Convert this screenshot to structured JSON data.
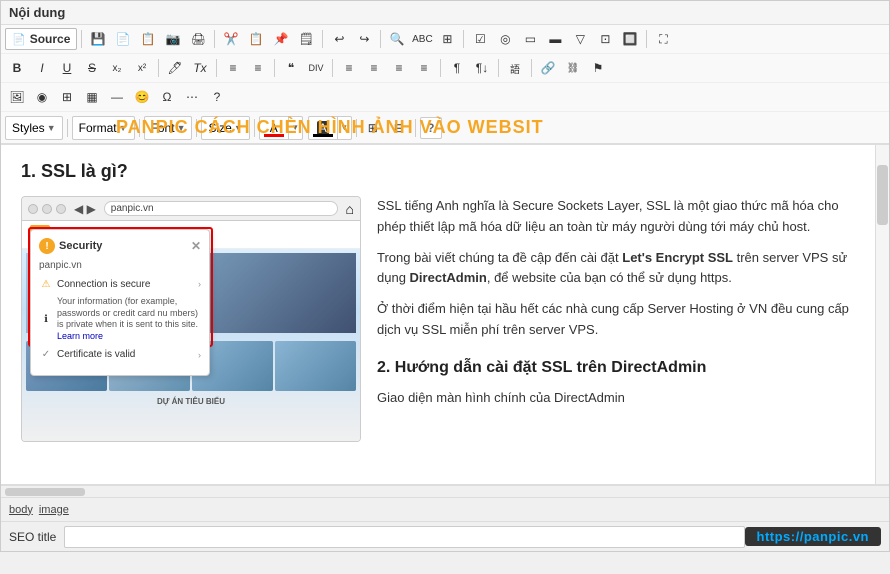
{
  "header": {
    "title": "Nội dung"
  },
  "toolbar": {
    "source_label": "Source",
    "row1_icons": [
      "💾",
      "📄",
      "📋",
      "📷",
      "✂️",
      "📋",
      "📌",
      "🔒",
      "↩️",
      "↪️",
      "🔍",
      "📊",
      "📋",
      "✔️",
      "⭕",
      "▭",
      "▭",
      "▬",
      "✏️"
    ],
    "row2_icons": [
      "B",
      "I",
      "U",
      "S",
      "x₂",
      "x²",
      "🖊",
      "Ix",
      "≡",
      "≡",
      "❝",
      "❝",
      "DIV",
      "≡",
      "≡",
      "≡",
      "≡",
      "¶",
      "¶",
      "語",
      "🔗",
      "⚑",
      "⚑"
    ],
    "row3_icons": [
      "🖼",
      "⊕",
      "▦",
      "▦",
      "🔧",
      "📸",
      "◎",
      "▲",
      "?"
    ]
  },
  "format_bar": {
    "styles_label": "Styles",
    "format_label": "Format",
    "font_label": "Font",
    "size_label": "Size",
    "text_color_label": "A",
    "bg_color_label": "A",
    "help_label": "?"
  },
  "banner": {
    "text": "PANPIC CÁCH CHÈN HÌNH ẢNH VÀO WEBSIT"
  },
  "content": {
    "heading1": "1. SSL là gì?",
    "paragraph1": "SSL tiếng Anh nghĩa là Secure Sockets Layer, SSL là một giao thức mã hóa cho phép thiết lập mã hóa dữ liệu an toàn từ máy người dùng  tới máy chủ host.",
    "paragraph2_prefix": "Trong bài viết chúng ta đề cập đến cài đặt ",
    "paragraph2_bold": "Let's Encrypt SSL",
    "paragraph2_suffix": " trên server VPS sử dụng ",
    "paragraph2_bold2": "DirectAdmin",
    "paragraph2_end": ", để website của bạn có thể sử dụng https.",
    "paragraph3": "Ở thời điểm hiện tại hầu hết các nhà cung cấp Server Hosting ở VN đều cung cấp dịch vụ SSL miễn phí trên server VPS.",
    "heading2": "2. Hướng dẫn cài đặt SSL trên DirectAdmin",
    "paragraph4": "Giao diện màn hình chính của DirectAdmin"
  },
  "browser_mock": {
    "url": "panpic.vn",
    "popup": {
      "title": "Security",
      "url": "panpic.vn",
      "items": [
        {
          "type": "warning",
          "text": "Connection is secure"
        },
        {
          "type": "info",
          "text": "Your information (for example, passwords or credit card nu mbers) is private when it is sent to this site. Learn more"
        },
        {
          "type": "ok",
          "text": "Certificate is valid"
        }
      ]
    }
  },
  "status_bar": {
    "tags": [
      "body",
      "image"
    ]
  },
  "seo": {
    "label": "SEO title",
    "url": "https://panpic.vn"
  }
}
